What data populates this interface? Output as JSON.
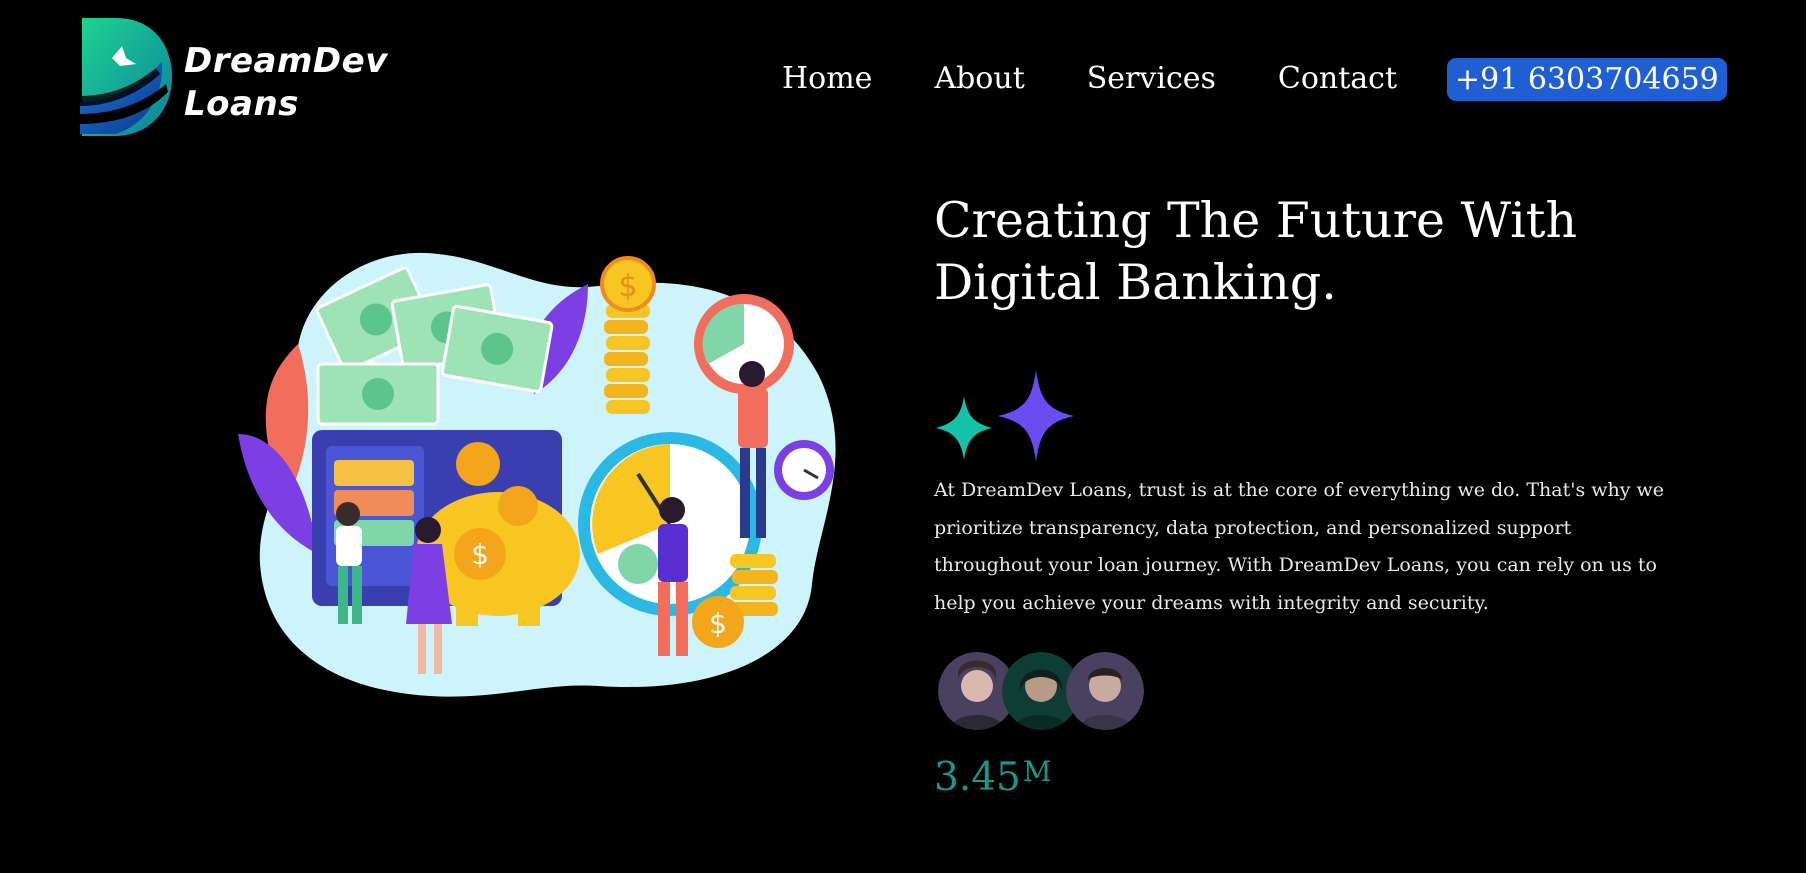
{
  "brand": {
    "line1": "DreamDev",
    "line2": "Loans"
  },
  "nav": {
    "items": [
      {
        "label": "Home"
      },
      {
        "label": "About"
      },
      {
        "label": "Services"
      },
      {
        "label": "Contact"
      }
    ],
    "phone_label": "+91 6303704659",
    "phone_color": "#1f5fd1"
  },
  "hero": {
    "title_line1": "Creating The Future With",
    "title_line2": "Digital Banking.",
    "description": "At DreamDev Loans, trust is at the core of everything we do. That's why we prioritize transparency, data protection, and personalized support throughout your loan journey. With DreamDev Loans, you can rely on us to help you achieve your dreams with integrity and security.",
    "stat_value": "3.45",
    "stat_suffix": "M",
    "stat_color": "#14998a"
  },
  "icons": [
    "logo-mark-icon",
    "sparkle-teal-icon",
    "sparkle-purple-icon",
    "finance-illustration"
  ]
}
